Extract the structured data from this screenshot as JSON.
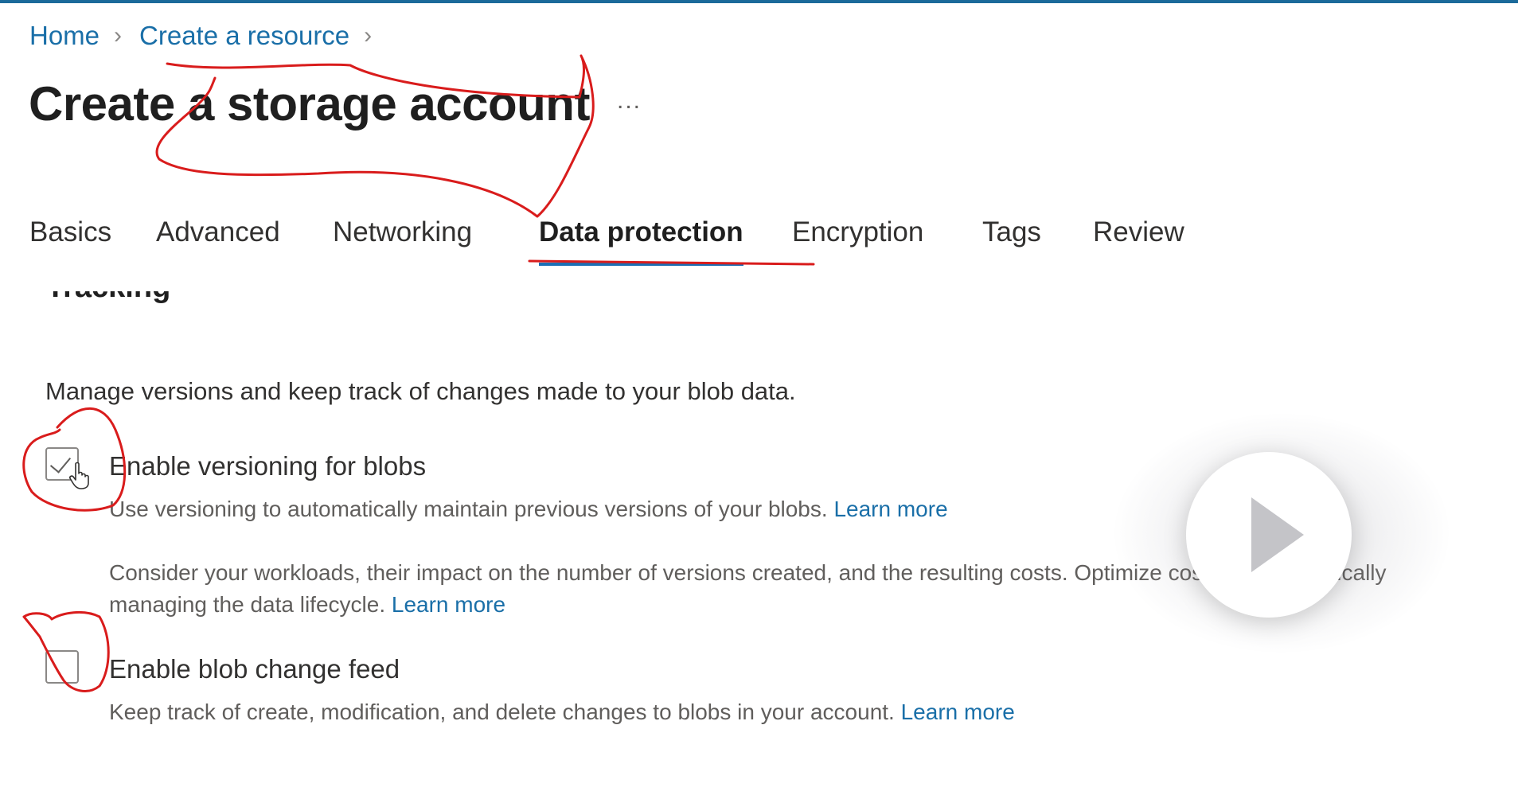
{
  "breadcrumb": {
    "items": [
      "Home",
      "Create a resource"
    ]
  },
  "page": {
    "title": "Create a storage account",
    "more_label": "..."
  },
  "tabs": [
    {
      "label": "Basics"
    },
    {
      "label": "Advanced"
    },
    {
      "label": "Networking"
    },
    {
      "label": "Data protection",
      "active": true
    },
    {
      "label": "Encryption"
    },
    {
      "label": "Tags"
    },
    {
      "label": "Review"
    }
  ],
  "section": {
    "heading": "Tracking",
    "description": "Manage versions and keep track of changes made to your blob data."
  },
  "versioning": {
    "label": "Enable versioning for blobs",
    "checked": true,
    "description": "Use versioning to automatically maintain previous versions of your blobs.",
    "learn_more": "Learn more",
    "note_line1": "Consider your workloads, their impact on the number of versions created, and the resulting costs. Optimize costs by automatically",
    "note_line2": "managing the data lifecycle.",
    "note_learn_more": "Learn more"
  },
  "change_feed": {
    "label": "Enable blob change feed",
    "checked": false,
    "description": "Keep track of create, modification, and delete changes to blobs in your account.",
    "learn_more": "Learn more"
  },
  "colors": {
    "link": "#1a6fa8",
    "tab_underline": "#1b6fb5",
    "annotation": "#d91c1c"
  }
}
